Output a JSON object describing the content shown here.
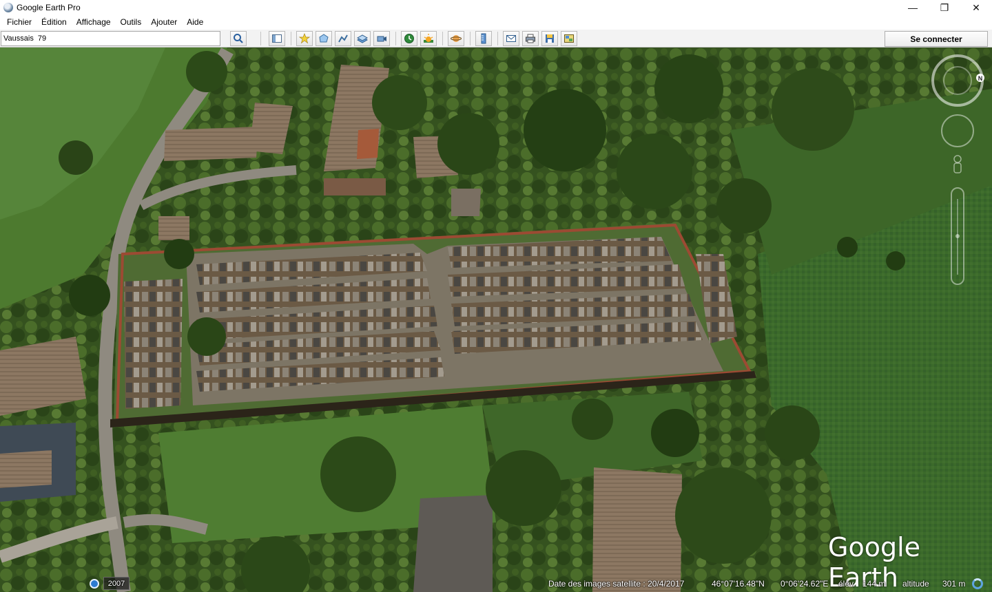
{
  "window": {
    "title": "Google Earth Pro",
    "minimize_label": "—",
    "maximize_label": "❐",
    "close_label": "✕"
  },
  "menu": [
    "Fichier",
    "Édition",
    "Affichage",
    "Outils",
    "Ajouter",
    "Aide"
  ],
  "search": {
    "value": "Vaussais  79"
  },
  "toolbar": {
    "buttons": [
      "search-icon",
      "sidebar-icon",
      "placemark-icon",
      "polygon-icon",
      "path-icon",
      "image-overlay-icon",
      "tour-icon",
      "historical-imagery-icon",
      "sun-icon",
      "planets-icon",
      "ruler-icon",
      "email-icon",
      "print-icon",
      "save-image-icon",
      "maps-icon"
    ],
    "connect_label": "Se connecter"
  },
  "map": {
    "brand": "Google Earth"
  },
  "status": {
    "year": "2007",
    "imagery_date": "Date des images satellite : 20/4/2017",
    "latitude": "46°07'16.48\"N",
    "longitude": "0°06'24.62\"E",
    "elevation_label": "élév.",
    "elevation": "144 m",
    "altitude_label": "altitude",
    "altitude": "301 m"
  },
  "nav": {
    "north_label": "N"
  }
}
